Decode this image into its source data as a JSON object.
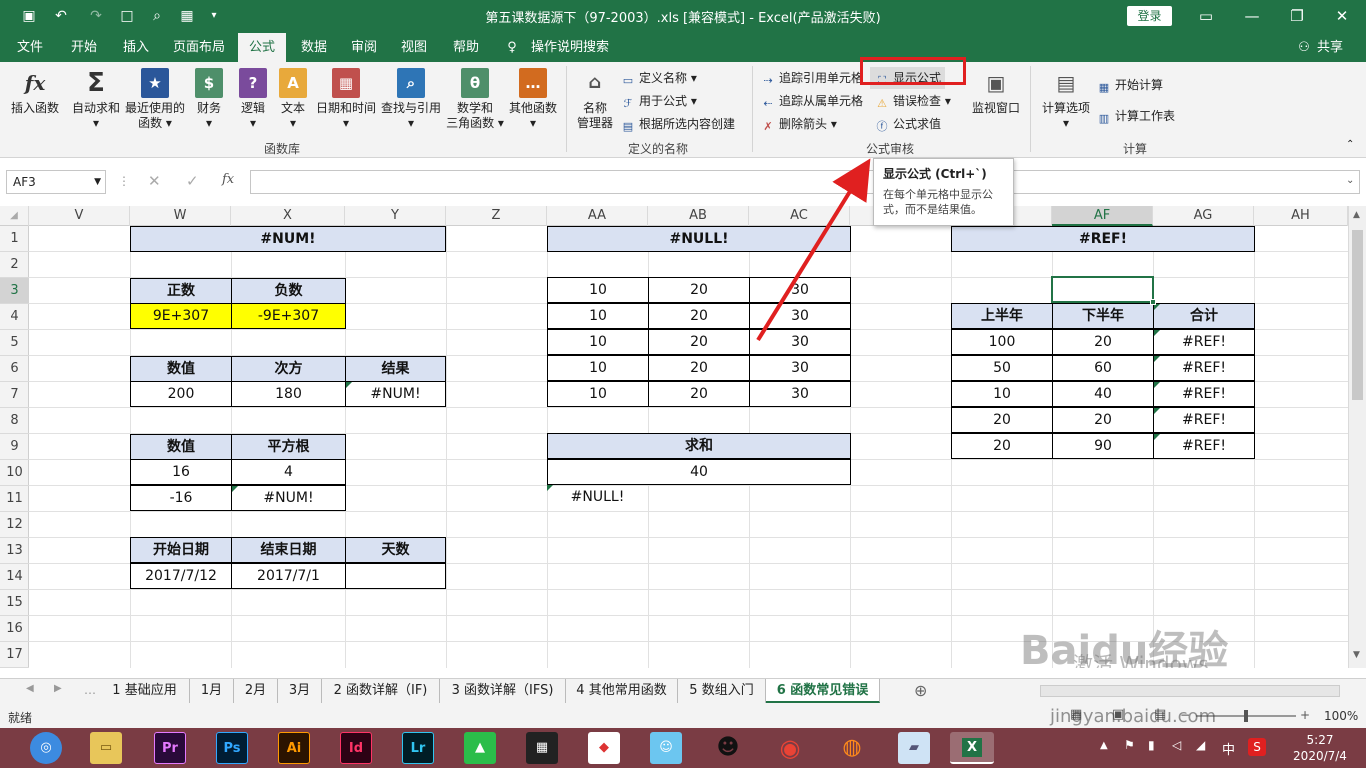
{
  "title": "第五课数据源下（97-2003）.xls  [兼容模式]  -  Excel(产品激活失败)",
  "login_label": "登录",
  "menu_tabs": [
    "文件",
    "开始",
    "插入",
    "页面布局",
    "公式",
    "数据",
    "审阅",
    "视图",
    "帮助",
    "操作说明搜索"
  ],
  "share_label": "共享",
  "ribbon": {
    "insert_function": "插入函数",
    "autosum": "自动求和",
    "recent_line1": "最近使用的",
    "recent_line2": "函数",
    "financial": "财务",
    "logical": "逻辑",
    "text": "文本",
    "datetime": "日期和时间",
    "lookup": "查找与引用",
    "math_line1": "数学和",
    "math_line2": "三角函数",
    "more": "其他函数",
    "group_library": "函数库",
    "name_manager_line1": "名称",
    "name_manager_line2": "管理器",
    "define_name": "定义名称",
    "use_in_formula": "用于公式",
    "create_from_selection": "根据所选内容创建",
    "group_names": "定义的名称",
    "trace_precedents": "追踪引用单元格",
    "show_formulas": "显示公式",
    "trace_dependents": "追踪从属单元格",
    "error_checking": "错误检查",
    "remove_arrows": "删除箭头",
    "evaluate_formula": "公式求值",
    "watch_window": "监视窗口",
    "group_auditing": "公式审核",
    "calc_options": "计算选项",
    "calc_now": "开始计算",
    "calc_sheet": "计算工作表",
    "group_calc": "计算"
  },
  "tooltip": {
    "title": "显示公式 (Ctrl+`)",
    "desc": "在每个单元格中显示公式，而不是结果值。"
  },
  "namebox": "AF3",
  "columns": [
    "V",
    "W",
    "X",
    "Y",
    "Z",
    "AA",
    "AB",
    "AC",
    "AD",
    "AE",
    "AF",
    "AG",
    "AH"
  ],
  "rows": [
    "1",
    "2",
    "3",
    "4",
    "5",
    "6",
    "7",
    "8",
    "9",
    "10",
    "11",
    "12",
    "13",
    "14",
    "15",
    "16",
    "17"
  ],
  "cells": {
    "num_title": "#NUM!",
    "pos": "正数",
    "neg": "负数",
    "pos_val": "9E+307",
    "neg_val": "-9E+307",
    "val1": "数值",
    "pow": "次方",
    "res": "结果",
    "v200": "200",
    "v180": "180",
    "num_err1": "#NUM!",
    "val2": "数值",
    "sqrt": "平方根",
    "v16": "16",
    "v4": "4",
    "vm16": "-16",
    "num_err2": "#NUM!",
    "start": "开始日期",
    "end": "结束日期",
    "days": "天数",
    "start_val": "2017/7/12",
    "end_val": "2017/7/1",
    "null_title": "#NULL!",
    "n10": "10",
    "n20": "20",
    "n30": "30",
    "sum_label": "求和",
    "sum_val": "40",
    "null_err": "#NULL!",
    "ref_title": "#REF!",
    "h1": "上半年",
    "h2": "下半年",
    "total": "合计",
    "r_a": [
      "100",
      "50",
      "10",
      "20",
      "20"
    ],
    "r_b": [
      "20",
      "60",
      "40",
      "20",
      "90"
    ],
    "ref_err": "#REF!"
  },
  "sheet_tabs": [
    "1 基础应用",
    "1月",
    "2月",
    "3月",
    "2 函数详解（IF)",
    "3 函数详解（IFS)",
    "4 其他常用函数",
    "5 数组入门",
    "6 函数常见错误"
  ],
  "status": {
    "ready": "就绪",
    "zoom": "100%"
  },
  "watermark": {
    "activate": "激活 Windows",
    "baidu": "Baidu经验",
    "url": "jingyan.baidu.com"
  },
  "clock": {
    "time": "5:27",
    "date": "2020/7/4"
  },
  "taskbar_apps": [
    "Pr",
    "Ps",
    "Ai",
    "Id",
    "Lr"
  ],
  "tray_ime": "中"
}
